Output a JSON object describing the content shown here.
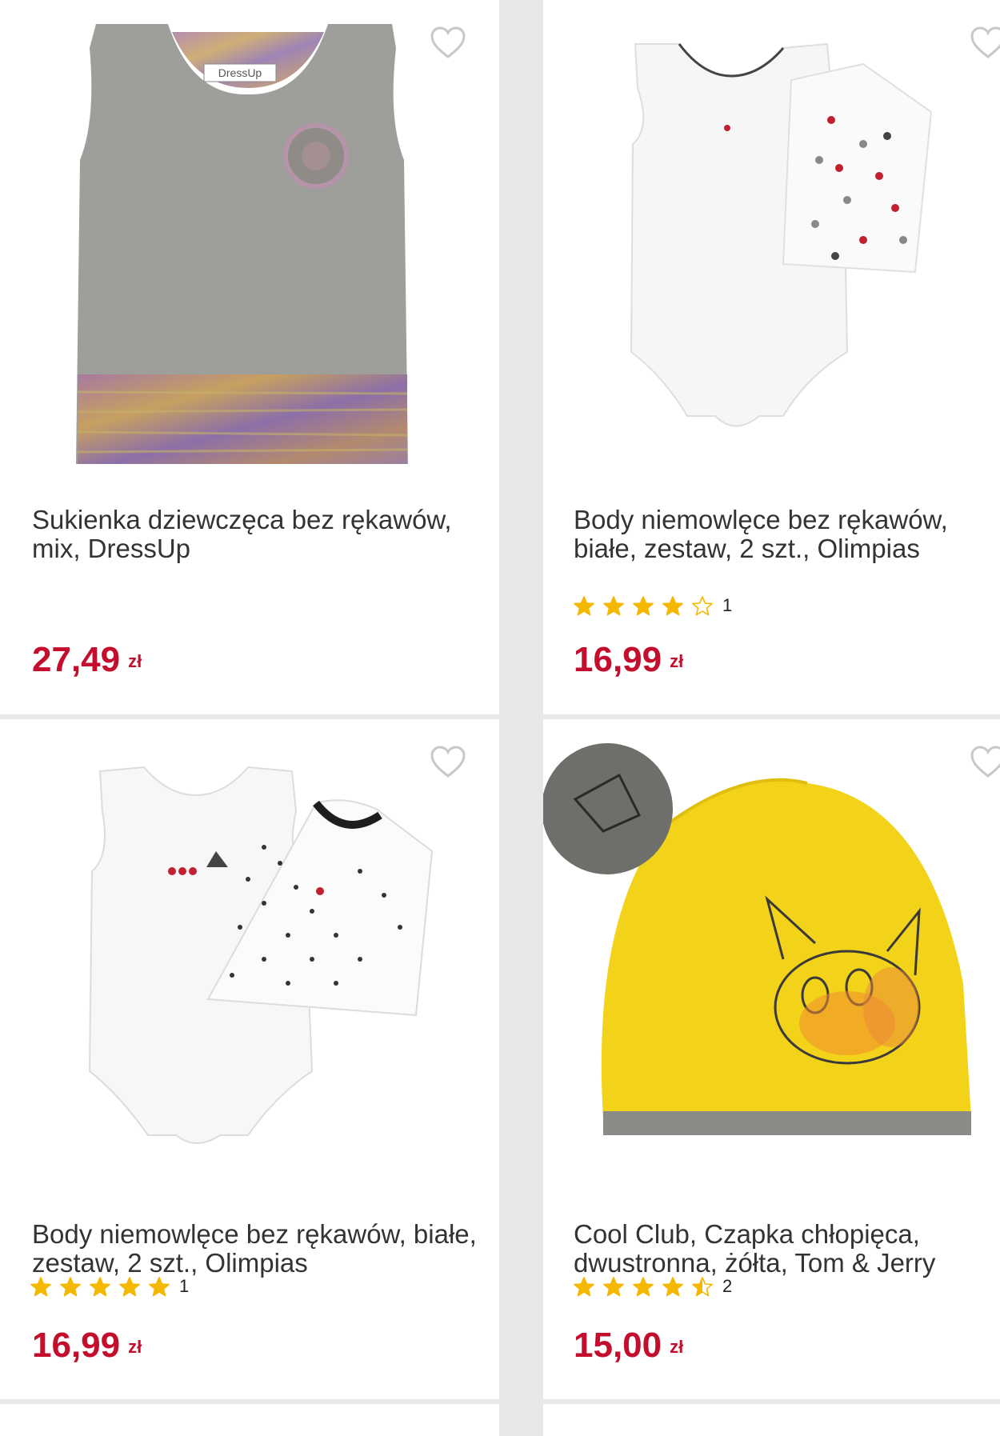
{
  "colors": {
    "price": "#c30e2e",
    "star": "#f5b800",
    "title": "#333333"
  },
  "products": [
    {
      "title": "Sukienka dziewczęca bez rękawów, mix, DressUp",
      "price": "27,49",
      "currency": "zł",
      "rating": null,
      "review_count": null,
      "image_brand_label": "DressUp",
      "favorite_icon": "heart-outline-icon"
    },
    {
      "title": "Body niemowlęce bez rękawów, białe, zestaw, 2 szt., Olimpias",
      "price": "16,99",
      "currency": "zł",
      "rating": 4,
      "review_count": "1",
      "favorite_icon": "heart-outline-icon"
    },
    {
      "title": "Body niemowlęce bez rękawów, białe, zestaw, 2 szt., Olimpias",
      "price": "16,99",
      "currency": "zł",
      "rating": 5,
      "review_count": "1",
      "favorite_icon": "heart-outline-icon"
    },
    {
      "title": "Cool Club, Czapka chłopięca, dwustronna, żółta, Tom & Jerry",
      "price": "15,00",
      "currency": "zł",
      "rating": 4.5,
      "review_count": "2",
      "favorite_icon": "heart-outline-icon"
    }
  ]
}
